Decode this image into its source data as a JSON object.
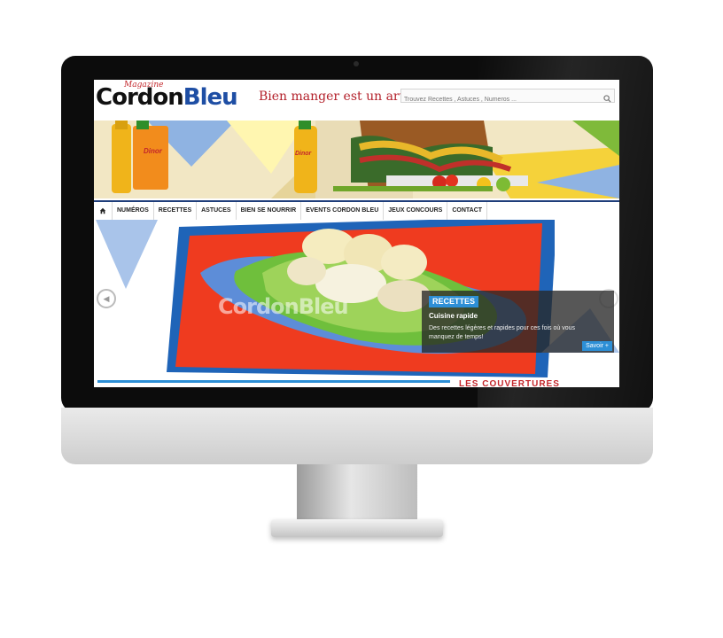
{
  "site": {
    "logo_script": "Magazine",
    "logo_part1": "Cordon",
    "logo_part2": "Bleu",
    "tagline": "Bien manger est un art"
  },
  "search": {
    "placeholder": "Trouvez Recettes , Astuces , Numeros ..."
  },
  "nav": {
    "items": [
      {
        "label": "NUMÉROS"
      },
      {
        "label": "RECETTES"
      },
      {
        "label": "ASTUCES"
      },
      {
        "label": "BIEN SE NOURRIR"
      },
      {
        "label": "EVENTS CORDON BLEU"
      },
      {
        "label": "JEUX CONCOURS"
      },
      {
        "label": "CONTACT"
      }
    ]
  },
  "banner": {
    "brand_label": "Dinor"
  },
  "slider": {
    "watermark": "CordonBleu",
    "category": "RECETTES",
    "title": "Cuisine rapide",
    "description": "Des recettes légères et rapides pour ces fois où vous manquez de temps!",
    "more_label": "Savoir +"
  },
  "section": {
    "heading": "LES COUVERTURES"
  },
  "colors": {
    "brand_red": "#c3262b",
    "brand_blue": "#1e4ea4",
    "accent_blue": "#2d8fd6",
    "nav_border": "#1f3e7a"
  },
  "icons": {
    "home": "home-icon",
    "search": "magnifier-icon",
    "prev": "chevron-left-icon",
    "next": "chevron-right-icon"
  }
}
